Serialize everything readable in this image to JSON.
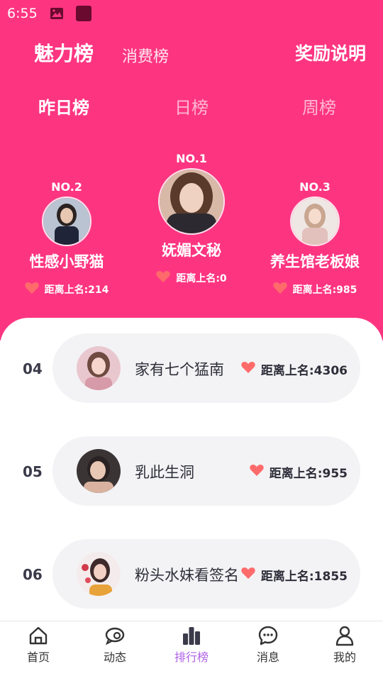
{
  "status_bar": {
    "time": "6:55"
  },
  "header": {
    "tab_active": "魅力榜",
    "tab_other": "消费榜",
    "reward_link": "奖励说明"
  },
  "period_tabs": [
    {
      "label": "昨日榜",
      "active": true
    },
    {
      "label": "日榜",
      "active": false
    },
    {
      "label": "周榜",
      "active": false
    }
  ],
  "top3": [
    {
      "rank": "NO.1",
      "name": "妩媚文秘",
      "distance": "距离上名:0"
    },
    {
      "rank": "NO.2",
      "name": "性感小野猫",
      "distance": "距离上名:214"
    },
    {
      "rank": "NO.3",
      "name": "养生馆老板娘",
      "distance": "距离上名:985"
    }
  ],
  "list": [
    {
      "rank": "04",
      "name": "家有七个猛南",
      "distance": "距离上名:4306"
    },
    {
      "rank": "05",
      "name": "乳此生洞",
      "distance": "距离上名:955"
    },
    {
      "rank": "06",
      "name": "粉头水妹看签名",
      "distance": "距离上名:1855"
    }
  ],
  "tabbar": [
    {
      "label": "首页",
      "icon": "home-icon",
      "active": false
    },
    {
      "label": "动态",
      "icon": "moments-icon",
      "active": false
    },
    {
      "label": "排行榜",
      "icon": "ranking-icon",
      "active": true
    },
    {
      "label": "消息",
      "icon": "message-icon",
      "active": false
    },
    {
      "label": "我的",
      "icon": "profile-icon",
      "active": false
    }
  ],
  "colors": {
    "brand_pink": "#fd3581",
    "active_tab": "#b061e6",
    "heart": "#ff6b6b"
  }
}
